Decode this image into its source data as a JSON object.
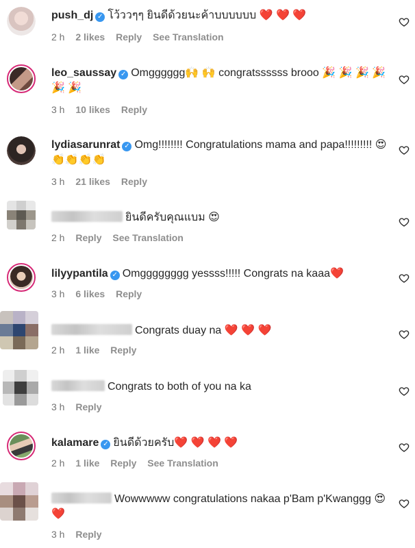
{
  "comments": [
    {
      "username": "push_dj",
      "verified": true,
      "text": "โว้ววๆๆ ยินดีด้วยนะค้าบบบบบบ ❤️ ❤️ ❤️",
      "time": "2 h",
      "likes": "2 likes",
      "reply": "Reply",
      "translate": "See Translation"
    },
    {
      "username": "leo_saussay",
      "verified": true,
      "text": "Omgggggg🙌 🙌  congratssssss brooo 🎉 🎉 🎉 🎉 🎉 🎉",
      "time": "3 h",
      "likes": "10 likes",
      "reply": "Reply"
    },
    {
      "username": "lydiasarunrat",
      "verified": true,
      "text": "Omg!!!!!!!! Congratulations mama and papa!!!!!!!!! 😍👏👏👏👏",
      "time": "3 h",
      "likes": "21 likes",
      "reply": "Reply"
    },
    {
      "username": "",
      "verified": false,
      "text": "ยินดีครับคุณแบม 😍",
      "time": "2 h",
      "reply": "Reply",
      "translate": "See Translation"
    },
    {
      "username": "lilyypantila",
      "verified": true,
      "text": "Omgggggggg yessss!!!!! Congrats na kaaa❤️",
      "time": "3 h",
      "likes": "6 likes",
      "reply": "Reply"
    },
    {
      "username": "",
      "verified": false,
      "text": "Congrats duay na ❤️ ❤️ ❤️",
      "time": "2 h",
      "likes": "1 like",
      "reply": "Reply"
    },
    {
      "username": "",
      "verified": false,
      "text": "Congrats to both of you na ka",
      "time": "3 h",
      "reply": "Reply"
    },
    {
      "username": "kalamare",
      "verified": true,
      "text": "ยินดีด้วยครับ❤️ ❤️ ❤️ ❤️",
      "time": "2 h",
      "likes": "1 like",
      "reply": "Reply",
      "translate": "See Translation"
    },
    {
      "username": "",
      "verified": false,
      "text": "Wowwwww congratulations nakaa p'Bam p'Kwanggg 😍❤️",
      "time": "3 h",
      "reply": "Reply"
    }
  ],
  "colors": {
    "text": "#262626",
    "meta": "#737373",
    "verified": "#3897f0",
    "story_ring": "#d62976"
  },
  "icons": {
    "verified": "verified-badge-icon",
    "like": "heart-outline-icon"
  }
}
